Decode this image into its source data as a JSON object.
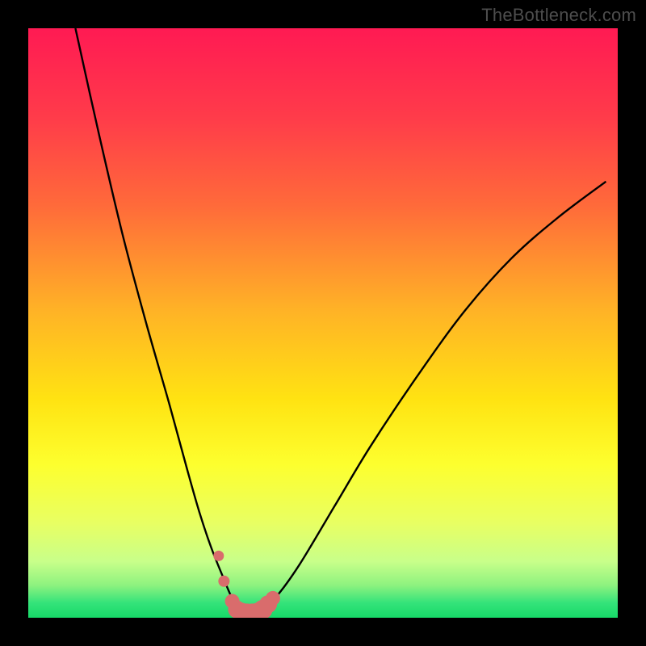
{
  "watermark": "TheBottleneck.com",
  "colors": {
    "frame": "#000000",
    "curve": "#000000",
    "marker": "#d96c6c",
    "green_band": "#34e37a"
  },
  "chart_data": {
    "type": "line",
    "title": "",
    "xlabel": "",
    "ylabel": "",
    "xlim": [
      0,
      100
    ],
    "ylim": [
      0,
      100
    ],
    "grid": false,
    "series": [
      {
        "name": "bottleneck-curve",
        "x": [
          8,
          12,
          16,
          20,
          24,
          27,
          29,
          31,
          33,
          34.5,
          36,
          37.5,
          39,
          42,
          46,
          52,
          58,
          66,
          74,
          82,
          90,
          98
        ],
        "y": [
          100,
          82,
          65,
          50,
          36,
          25,
          18,
          12,
          7,
          3.5,
          1.2,
          0.6,
          1.0,
          3.5,
          9,
          19,
          29,
          41,
          52,
          61,
          68,
          74
        ]
      }
    ],
    "annotations": [
      {
        "text": "TheBottleneck.com",
        "position": "top-right"
      }
    ],
    "markers": {
      "name": "highlight-dots",
      "x": [
        33.2,
        34.6,
        35.4,
        36.2,
        37.1,
        38.0,
        38.9,
        39.8,
        40.7,
        41.5
      ],
      "y": [
        6.2,
        2.8,
        1.4,
        0.9,
        0.7,
        0.7,
        0.9,
        1.4,
        2.3,
        3.3
      ]
    },
    "gradient_stops": [
      {
        "offset": 0.0,
        "color": "#ff1a53"
      },
      {
        "offset": 0.15,
        "color": "#ff3b4a"
      },
      {
        "offset": 0.3,
        "color": "#ff6a3a"
      },
      {
        "offset": 0.48,
        "color": "#ffb326"
      },
      {
        "offset": 0.63,
        "color": "#ffe312"
      },
      {
        "offset": 0.74,
        "color": "#fdff2e"
      },
      {
        "offset": 0.84,
        "color": "#e8ff63"
      },
      {
        "offset": 0.905,
        "color": "#c8ff8a"
      },
      {
        "offset": 0.945,
        "color": "#8df27f"
      },
      {
        "offset": 0.975,
        "color": "#34e37a"
      },
      {
        "offset": 1.0,
        "color": "#17d968"
      }
    ]
  }
}
